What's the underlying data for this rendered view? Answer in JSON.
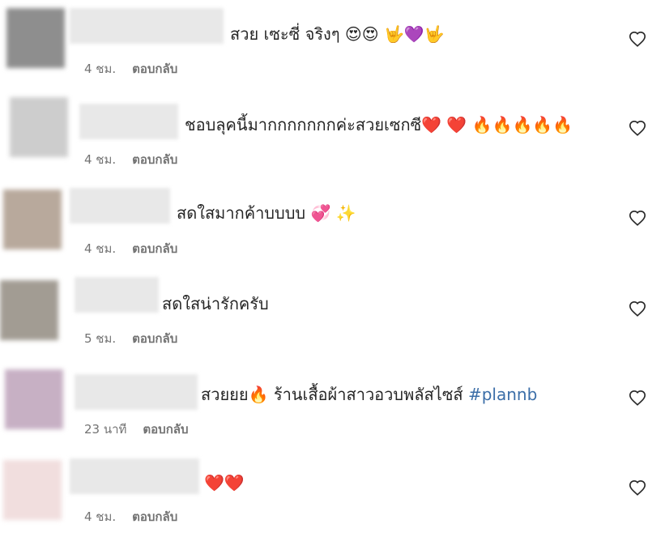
{
  "comments": [
    {
      "text": "สวย เซะซี่ จริงๆ 😍😍 🤟💜🤟",
      "hashtag": "",
      "time": "4 ชม.",
      "reply": "ตอบกลับ",
      "avatar_color": "#8e8e8e"
    },
    {
      "text": "ชอบลุคนี้มากกกกกกกค่ะสวยเซกซี❤️ ❤️ 🔥🔥🔥🔥🔥",
      "hashtag": "",
      "time": "4 ชม.",
      "reply": "ตอบกลับ",
      "avatar_color": "#cdcdcd"
    },
    {
      "text": "สดใสมากค้าบบบบ 💞 ✨",
      "hashtag": "",
      "time": "4 ชม.",
      "reply": "ตอบกลับ",
      "avatar_color": "#b8a99c"
    },
    {
      "text": "สดใสน่ารักครับ",
      "hashtag": "",
      "time": "5 ชม.",
      "reply": "ตอบกลับ",
      "avatar_color": "#a29c93"
    },
    {
      "text": "สวยยย🔥 ร้านเสื้อผ้าสาวอวบพลัสไซส์ ",
      "hashtag": "#plannb",
      "time": "23 นาที",
      "reply": "ตอบกลับ",
      "avatar_color": "#c7b0c4"
    },
    {
      "text": "❤️❤️",
      "hashtag": "",
      "time": "4 ชม.",
      "reply": "ตอบกลับ",
      "avatar_color": "#f1dede"
    }
  ]
}
